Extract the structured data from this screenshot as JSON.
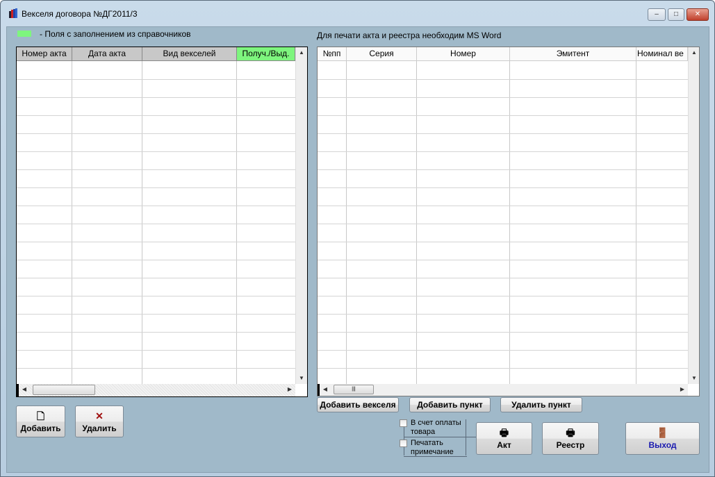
{
  "window": {
    "title": "Векселя договора №ДГ2011/3",
    "minimize": "–",
    "maximize": "□",
    "close": "✕"
  },
  "legend": {
    "text": "-  Поля с заполнением из справочников",
    "color": "#7ef57e"
  },
  "word_note": "Для печати акта и реестра необходим MS Word",
  "left_table": {
    "columns": [
      "Номер акта",
      "Дата акта",
      "Вид векселей",
      "Получ./Выд."
    ],
    "rows": []
  },
  "right_table": {
    "columns": [
      "№пп",
      "Серия",
      "Номер",
      "Эмитент",
      "Номинал ве"
    ],
    "rows": []
  },
  "buttons": {
    "add": "Добавить",
    "delete": "Удалить",
    "add_bills": "Добавить векселя",
    "add_item": "Добавить пункт",
    "delete_item": "Удалить пункт",
    "act": "Акт",
    "registry": "Реестр",
    "exit": "Выход"
  },
  "checkboxes": {
    "payment": {
      "line1": "В счет оплаты",
      "line2": "товара",
      "checked": false
    },
    "print_note": {
      "line1": "Печатать",
      "line2": "примечание",
      "checked": false
    }
  }
}
